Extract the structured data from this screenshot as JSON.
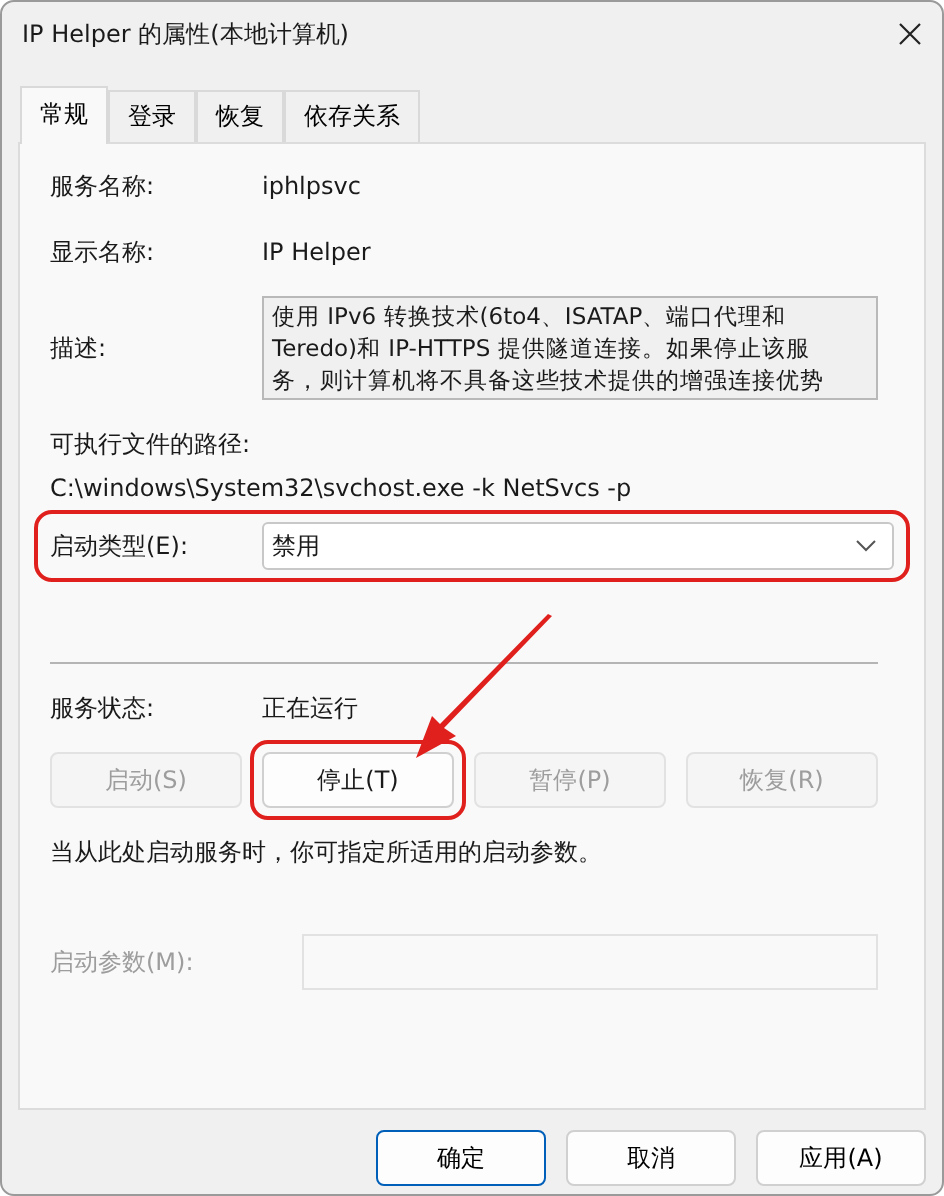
{
  "window": {
    "title": "IP Helper 的属性(本地计算机)"
  },
  "tabs": [
    {
      "label": "常规",
      "selected": true
    },
    {
      "label": "登录",
      "selected": false
    },
    {
      "label": "恢复",
      "selected": false
    },
    {
      "label": "依存关系",
      "selected": false
    }
  ],
  "service_name": {
    "label": "服务名称:",
    "value": "iphlpsvc"
  },
  "display_name": {
    "label": "显示名称:",
    "value": "IP Helper"
  },
  "description": {
    "label": "描述:",
    "value": "使用 IPv6 转换技术(6to4、ISATAP、端口代理和 Teredo)和 IP-HTTPS 提供隧道连接。如果停止该服务，则计算机将不具备这些技术提供的增强连接优势"
  },
  "executable_path": {
    "label": "可执行文件的路径:",
    "value": "C:\\windows\\System32\\svchost.exe -k NetSvcs -p"
  },
  "startup_type": {
    "label": "启动类型(E):",
    "value": "禁用",
    "highlighted": true
  },
  "service_status": {
    "label": "服务状态:",
    "value": "正在运行"
  },
  "service_buttons": [
    {
      "label": "启动(S)",
      "disabled": true,
      "highlighted": false
    },
    {
      "label": "停止(T)",
      "disabled": false,
      "highlighted": true
    },
    {
      "label": "暂停(P)",
      "disabled": true,
      "highlighted": false
    },
    {
      "label": "恢复(R)",
      "disabled": true,
      "highlighted": false
    }
  ],
  "note": "当从此处启动服务时，你可指定所适用的启动参数。",
  "start_parameters": {
    "label": "启动参数(M):",
    "disabled": true
  },
  "annotation_arrow": true,
  "dialog_buttons": [
    {
      "label": "确定",
      "default": true
    },
    {
      "label": "取消",
      "default": false
    },
    {
      "label": "应用(A)",
      "default": false
    }
  ]
}
